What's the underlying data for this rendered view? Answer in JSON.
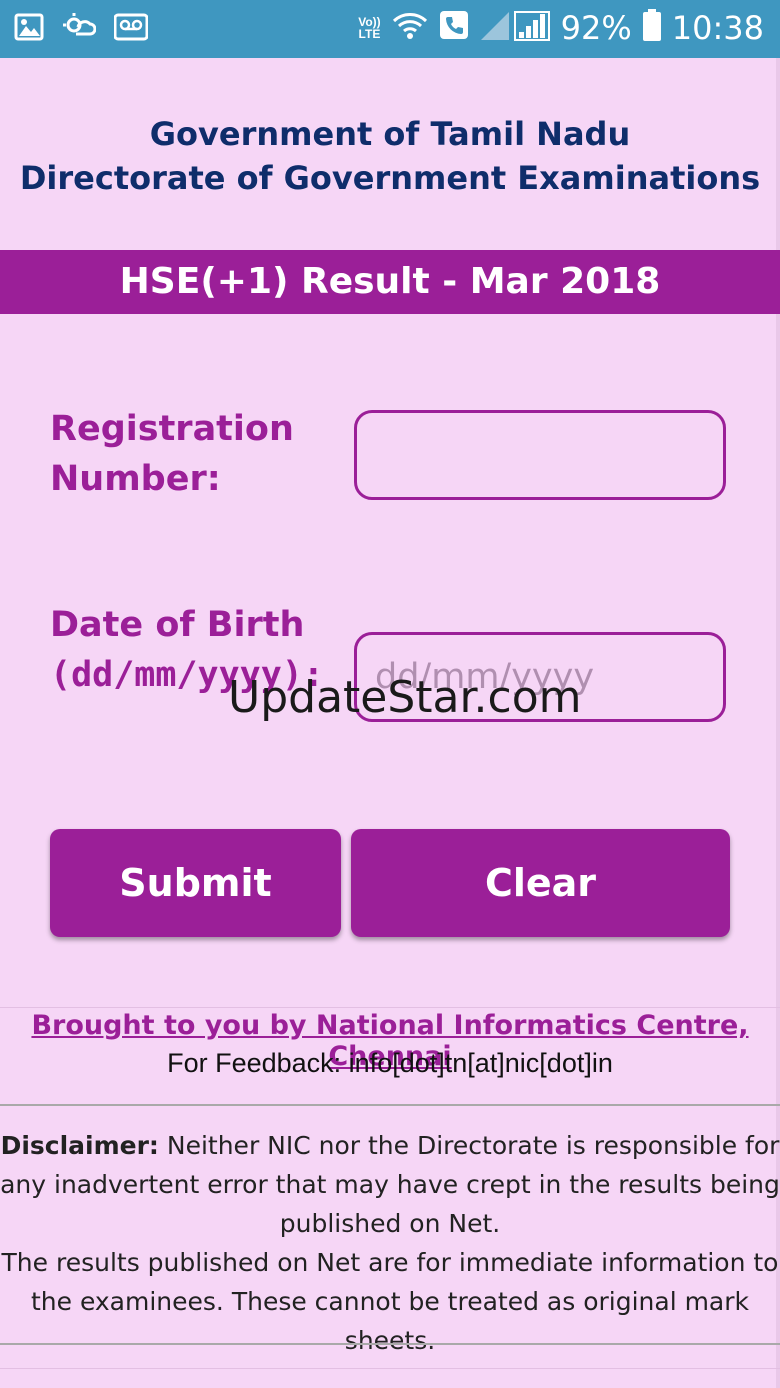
{
  "status_bar": {
    "icons": [
      "image-icon",
      "weather-icon",
      "voicemail-icon",
      "volte-icon",
      "wifi-icon",
      "call-icon",
      "signal-icon",
      "battery-icon"
    ],
    "volte_top": "Vo))",
    "volte_bottom": "LTE",
    "battery": "92%",
    "time": "10:38"
  },
  "header": {
    "line1": "Government of Tamil Nadu",
    "line2": "Directorate of Government Examinations"
  },
  "title": "HSE(+1) Result - Mar 2018",
  "form": {
    "reg_label_1": "Registration",
    "reg_label_2": "Number:",
    "reg_value": "",
    "dob_label_1": "Date of Birth",
    "dob_label_2": "(dd/mm/yyyy):",
    "dob_placeholder": "dd/mm/yyyy",
    "submit": "Submit",
    "clear": "Clear"
  },
  "watermark": "UpdateStar.com",
  "footer": {
    "credit": "Brought to you by National Informatics Centre, Chennai",
    "feedback": "For Feedback: info[dot]tn[at]nic[dot]in",
    "disclaimer_label": "Disclaimer:",
    "disclaimer_text": " Neither NIC nor the Directorate is responsible for any inadvertent error that may have crept in the results being published on Net.",
    "disclaimer_text2": "The results published on Net are for immediate information to the examinees. These cannot be treated as original mark sheets."
  },
  "colors": {
    "status_bar": "#3f97c0",
    "background": "#f6d6f6",
    "accent": "#9b1f98",
    "header_text": "#0f2d6b"
  }
}
